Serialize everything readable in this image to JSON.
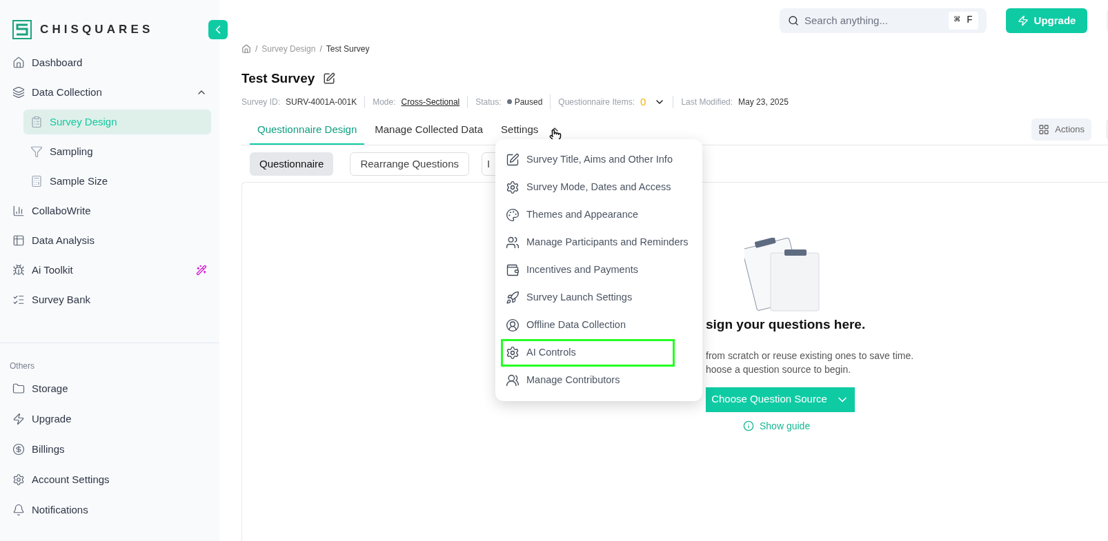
{
  "brand": {
    "name": "CHISQUARES"
  },
  "sidebar": {
    "items": [
      {
        "label": "Dashboard",
        "selected": false
      },
      {
        "label": "Data Collection",
        "selected": false,
        "expanded": true,
        "children": [
          {
            "label": "Survey Design",
            "selected": true
          },
          {
            "label": "Sampling",
            "selected": false
          },
          {
            "label": "Sample Size",
            "selected": false
          }
        ]
      },
      {
        "label": "CollaboWrite",
        "selected": false
      },
      {
        "label": "Data Analysis",
        "selected": false
      },
      {
        "label": "Ai Toolkit",
        "selected": false
      },
      {
        "label": "Survey Bank",
        "selected": false
      }
    ],
    "section_title": "Others",
    "other_items": [
      {
        "label": "Storage"
      },
      {
        "label": "Upgrade"
      },
      {
        "label": "Billings"
      },
      {
        "label": "Account Settings"
      },
      {
        "label": "Notifications"
      }
    ]
  },
  "topbar": {
    "search": {
      "placeholder": "Search anything...",
      "shortcut": "⌘ F"
    },
    "upgrade_button": "Upgrade"
  },
  "breadcrumb": {
    "separator": "/",
    "items": [
      "Survey Design",
      "Test Survey"
    ]
  },
  "survey": {
    "title": "Test Survey",
    "meta": [
      {
        "label": "Survey ID:",
        "value": "SURV-4001A-001K",
        "kind": "plain"
      },
      {
        "label": "Mode:",
        "value": "Cross-Sectional",
        "kind": "link"
      },
      {
        "label": "Status:",
        "value": "Paused",
        "kind": "status"
      },
      {
        "label": "Questionnaire Items:",
        "value": "0",
        "kind": "count"
      },
      {
        "label": "Last Modified:",
        "value": "May 23, 2025",
        "kind": "plain"
      }
    ]
  },
  "tabs": [
    {
      "label": "Questionnaire Design",
      "selected": true,
      "kind": "tab"
    },
    {
      "label": "Manage Collected Data",
      "selected": false,
      "kind": "tab"
    },
    {
      "label": "Settings",
      "selected": false,
      "kind": "menu",
      "expanded": true
    }
  ],
  "actions_button": "Actions",
  "subtabs": [
    {
      "label": "Questionnaire",
      "selected": true
    },
    {
      "label": "Rearrange Questions",
      "selected": false
    },
    {
      "label": "I",
      "selected": false
    }
  ],
  "settings_menu": [
    {
      "label": "Survey Title, Aims and Other Info",
      "highlighted": false
    },
    {
      "label": "Survey Mode, Dates and Access",
      "highlighted": false
    },
    {
      "label": "Themes and Appearance",
      "highlighted": false
    },
    {
      "label": "Manage Participants and Reminders",
      "highlighted": false
    },
    {
      "label": "Incentives and Payments",
      "highlighted": false
    },
    {
      "label": "Survey Launch Settings",
      "highlighted": false
    },
    {
      "label": "Offline Data Collection",
      "highlighted": false
    },
    {
      "label": "AI Controls",
      "highlighted": true
    },
    {
      "label": "Manage Contributors",
      "highlighted": false
    }
  ],
  "empty_state": {
    "heading": "sign your questions here.",
    "lines": [
      "from scratch or reuse existing ones to save time.",
      "hoose a question source to begin."
    ],
    "button": "Choose Question Source",
    "guide_link": "Show guide"
  }
}
